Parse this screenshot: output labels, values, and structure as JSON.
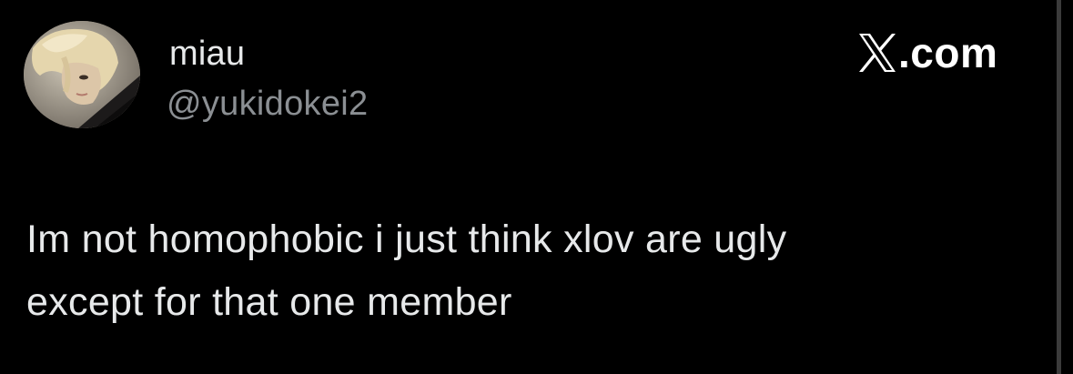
{
  "author": {
    "display_name": "miau",
    "handle": "@yukidokei2"
  },
  "brand": {
    "icon": "x-logo-icon",
    "text": ".com"
  },
  "tweet": {
    "lines": [
      "Im not homophobic i just think xlov are ugly",
      "except for that one member"
    ]
  },
  "colors": {
    "background": "#000000",
    "primary_text": "#e7e9ea",
    "secondary_text": "#8b8f93",
    "brand": "#ffffff"
  }
}
